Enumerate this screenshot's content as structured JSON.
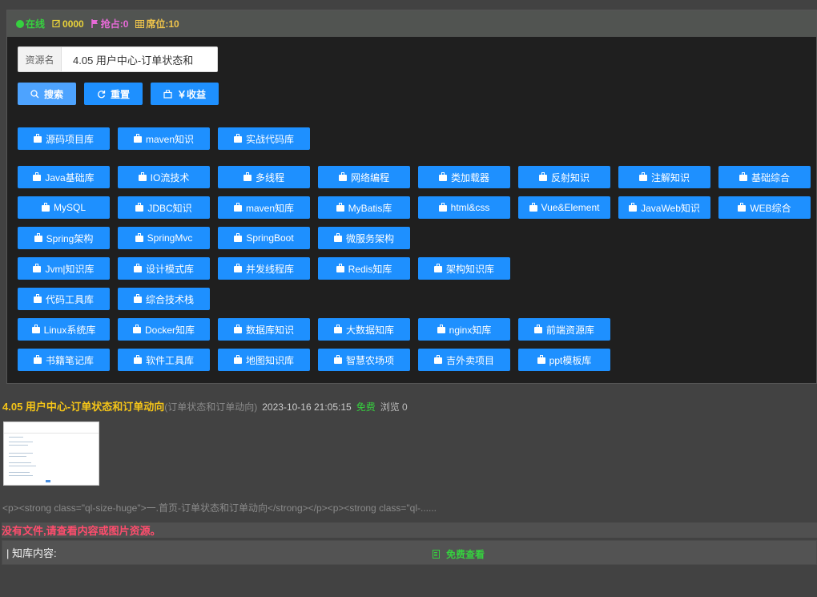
{
  "status": {
    "online": "在线",
    "count": "0000",
    "grab": "抢占:0",
    "seats": "席位:10"
  },
  "search": {
    "label": "资源名",
    "value": "4.05 用户中心-订单状态和"
  },
  "buttons": {
    "search": "搜索",
    "reset": "重置",
    "income": "￥收益"
  },
  "tag_rows": [
    [
      "源码项目库",
      "maven知识",
      "实战代码库"
    ],
    [
      "Java基础库",
      "IO流技术",
      "多线程",
      "网络编程",
      "类加载器",
      "反射知识",
      "注解知识",
      "基础综合"
    ],
    [
      "MySQL",
      "JDBC知识",
      "maven知库",
      "MyBatis库",
      "html&css",
      "Vue&Element",
      "JavaWeb知识",
      "WEB综合"
    ],
    [
      "Spring架构",
      "SpringMvc",
      "SpringBoot",
      "微服务架构"
    ],
    [
      "Jvm|知识库",
      "设计模式库",
      "并发线程库",
      "Redis知库",
      "架构知识库"
    ],
    [
      "代码工具库",
      "综合技术栈"
    ],
    [
      "Linux系统库",
      "Docker知库",
      "数据库知识",
      "大数据知库",
      "nginx知库",
      "前端资源库"
    ],
    [
      "书籍笔记库",
      "软件工具库",
      "地图知识库",
      "智慧农场项",
      "吉外卖项目",
      "ppt模板库"
    ]
  ],
  "result": {
    "title": "4.05 用户中心-订单状态和订单动向",
    "subtitle": "(订单状态和订单动向)",
    "date": "2023-10-16 21:05:15",
    "price": "免费",
    "views": "浏览 0",
    "excerpt": "<p><strong class=\"ql-size-huge\">一.首页-订单状态和订单动向</strong></p><p><strong class=\"ql-......",
    "no_file": "没有文件,请查看内容或图片资源。",
    "kb_label": "| 知库内容:",
    "kb_action": "免费查看"
  },
  "colors": {
    "accent": "#1e90ff",
    "online": "#36d13f",
    "title": "#f5c518",
    "warning": "#ff4d6d"
  }
}
